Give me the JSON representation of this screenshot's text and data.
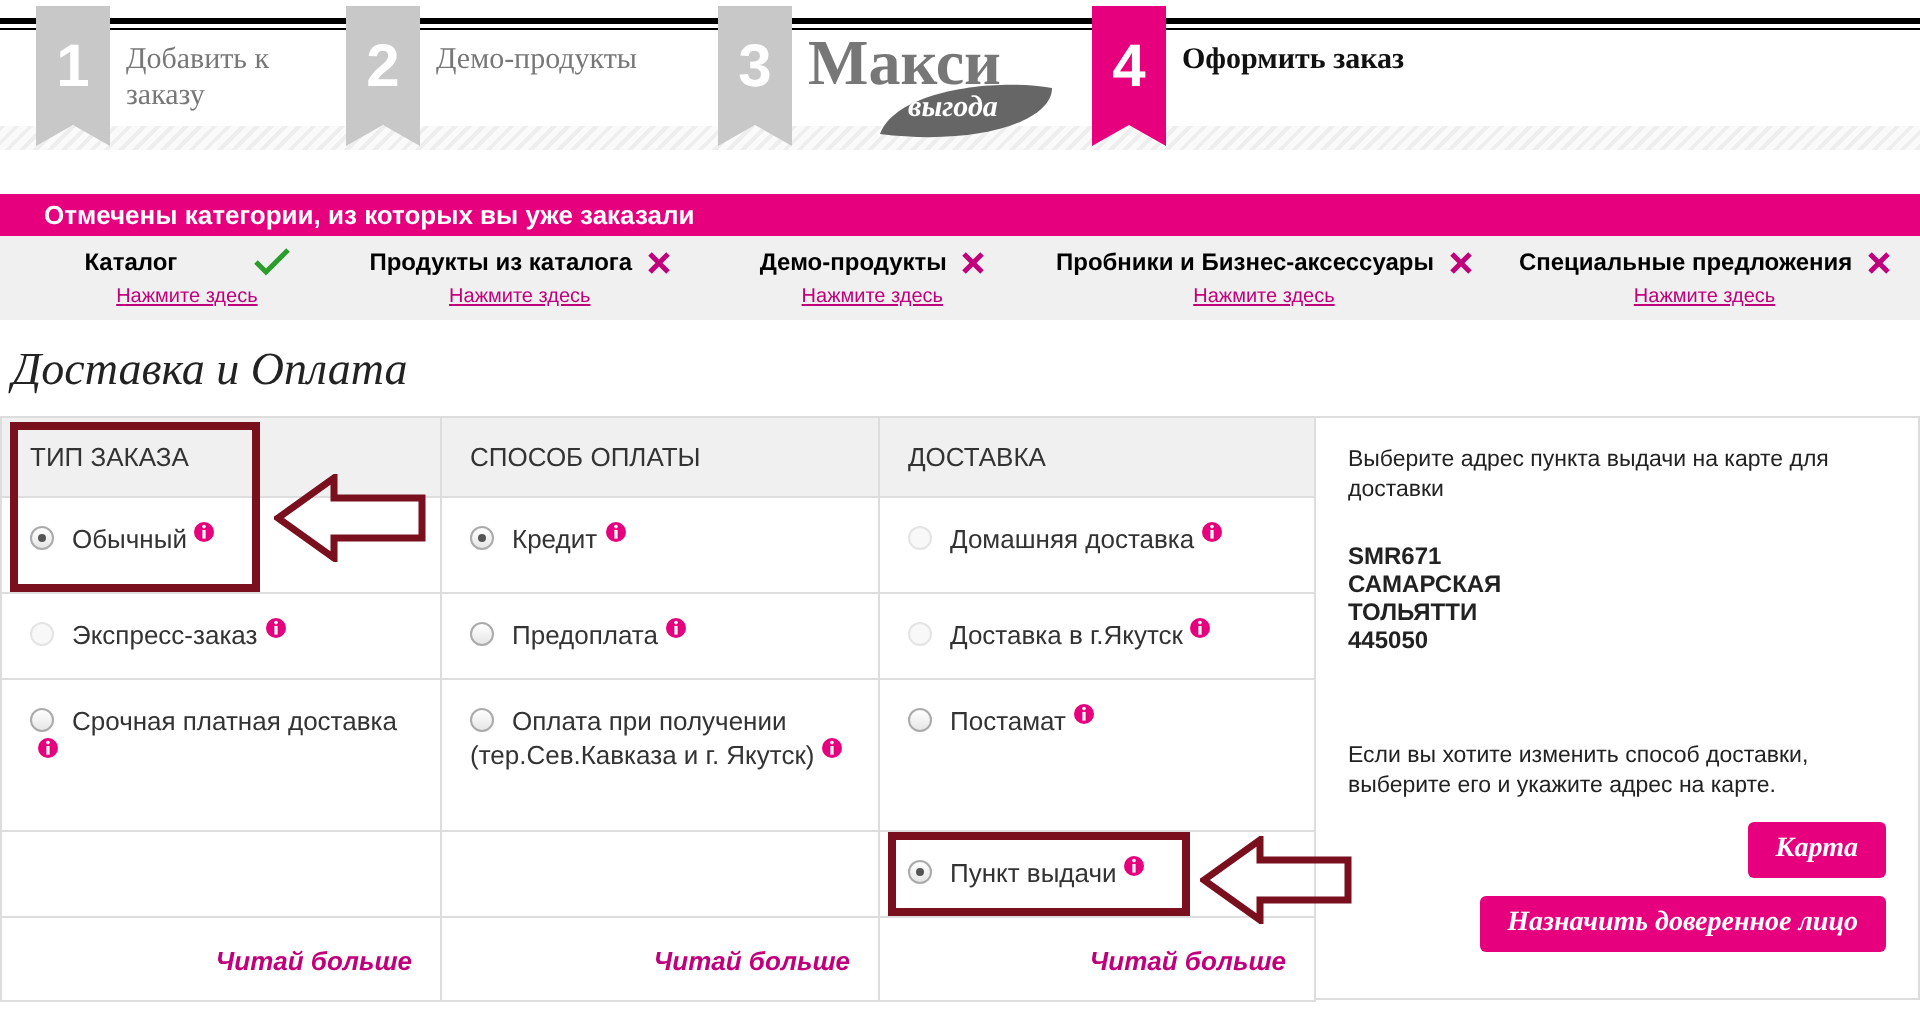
{
  "steps": [
    {
      "number": "1",
      "kind": "text",
      "label": "Добавить к заказу",
      "selected": false
    },
    {
      "number": "2",
      "kind": "text",
      "label": "Демо-продукты",
      "selected": false
    },
    {
      "number": "3",
      "kind": "logo",
      "label": "Макси",
      "sublabel": "выгода",
      "selected": false
    },
    {
      "number": "4",
      "kind": "text",
      "label": "Оформить заказ",
      "selected": true
    }
  ],
  "notice": "Отмечены категории, из которых вы уже заказали",
  "categories": [
    {
      "name": "Каталог",
      "ordered": true,
      "link": "Нажмите здесь"
    },
    {
      "name": "Продукты из каталога",
      "ordered": false,
      "link": "Нажмите здесь"
    },
    {
      "name": "Демо-продукты",
      "ordered": false,
      "link": "Нажмите здесь"
    },
    {
      "name": "Пробники и Бизнес-аксессуары",
      "ordered": false,
      "link": "Нажмите здесь"
    },
    {
      "name": "Специальные предложения",
      "ordered": false,
      "link": "Нажмите здесь"
    }
  ],
  "heading": "Доставка и Оплата",
  "columns": [
    {
      "header": "ТИП ЗАКАЗА",
      "more": "Читай больше",
      "options": [
        {
          "label": "Обычный",
          "selected": true,
          "disabled": false,
          "highlighted": true
        },
        {
          "label": "Экспресс-заказ",
          "selected": false,
          "disabled": true,
          "highlighted": false
        },
        {
          "label": "Срочная платная доставка",
          "selected": false,
          "disabled": false,
          "highlighted": false
        }
      ]
    },
    {
      "header": "СПОСОБ ОПЛАТЫ",
      "more": "Читай больше",
      "options": [
        {
          "label": "Кредит",
          "selected": true,
          "disabled": false,
          "highlighted": false
        },
        {
          "label": "Предоплата",
          "selected": false,
          "disabled": false,
          "highlighted": false
        },
        {
          "label": "Оплата при получении (тер.Сев.Кавказа и г. Якутск)",
          "selected": false,
          "disabled": false,
          "highlighted": false
        }
      ]
    },
    {
      "header": "ДОСТАВКА",
      "more": "Читай больше",
      "options": [
        {
          "label": "Домашняя доставка",
          "selected": false,
          "disabled": true,
          "highlighted": false
        },
        {
          "label": "Доставка в г.Якутск",
          "selected": false,
          "disabled": true,
          "highlighted": false
        },
        {
          "label": "Постамат",
          "selected": false,
          "disabled": false,
          "highlighted": false
        },
        {
          "label": "Пункт выдачи",
          "selected": true,
          "disabled": false,
          "highlighted": true
        }
      ]
    }
  ],
  "panel": {
    "intro": "Выберите адрес  пункта выдачи на карте для доставки",
    "address": [
      "SMR671",
      "САМАРСКАЯ",
      "ТОЛЬЯТТИ",
      "445050"
    ],
    "note": "Если вы хотите изменить способ доставки, выберите его и укажите адрес на карте.",
    "buttons": [
      "Карта",
      "Назначить доверенное лицо"
    ]
  }
}
